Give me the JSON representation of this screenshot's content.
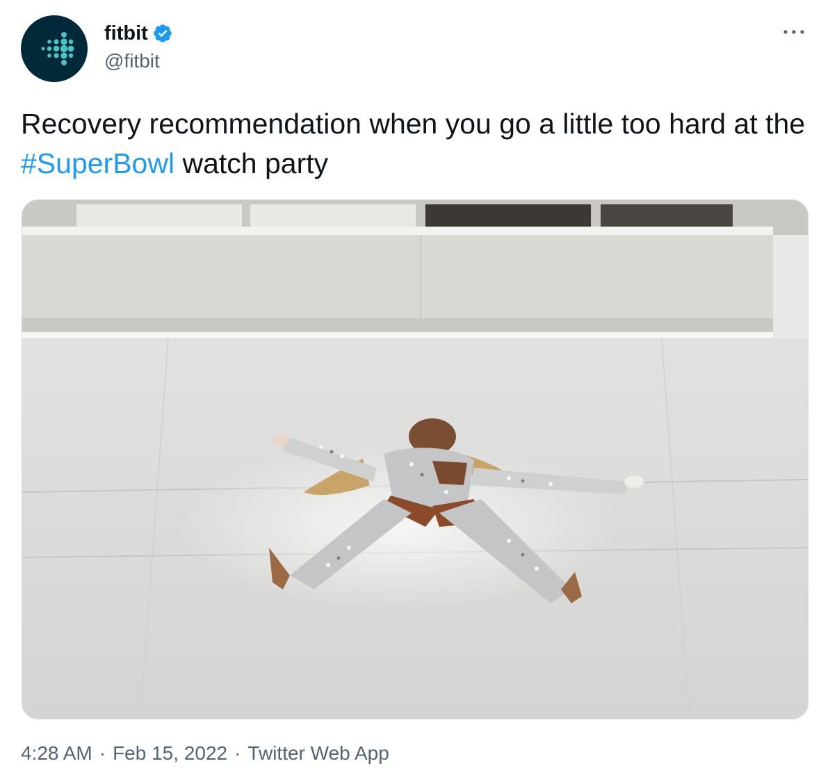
{
  "author": {
    "display_name": "fitbit",
    "handle": "@fitbit",
    "verified": true,
    "avatar_icon": "fitbit-logo-icon",
    "avatar_bg": "#002a3a",
    "avatar_dot_color": "#4cc2c4"
  },
  "more_icon": "more-options-icon",
  "tweet": {
    "text_part1": "Recovery recommendation when you go a little too hard at the ",
    "hashtag": "#SuperBowl",
    "text_part2": " watch party",
    "hashtag_color": "#1d9bf0"
  },
  "media": {
    "type": "photo"
  },
  "meta": {
    "time": "4:28 AM",
    "date": "Feb 15, 2022",
    "source": "Twitter Web App",
    "separator": "·"
  }
}
